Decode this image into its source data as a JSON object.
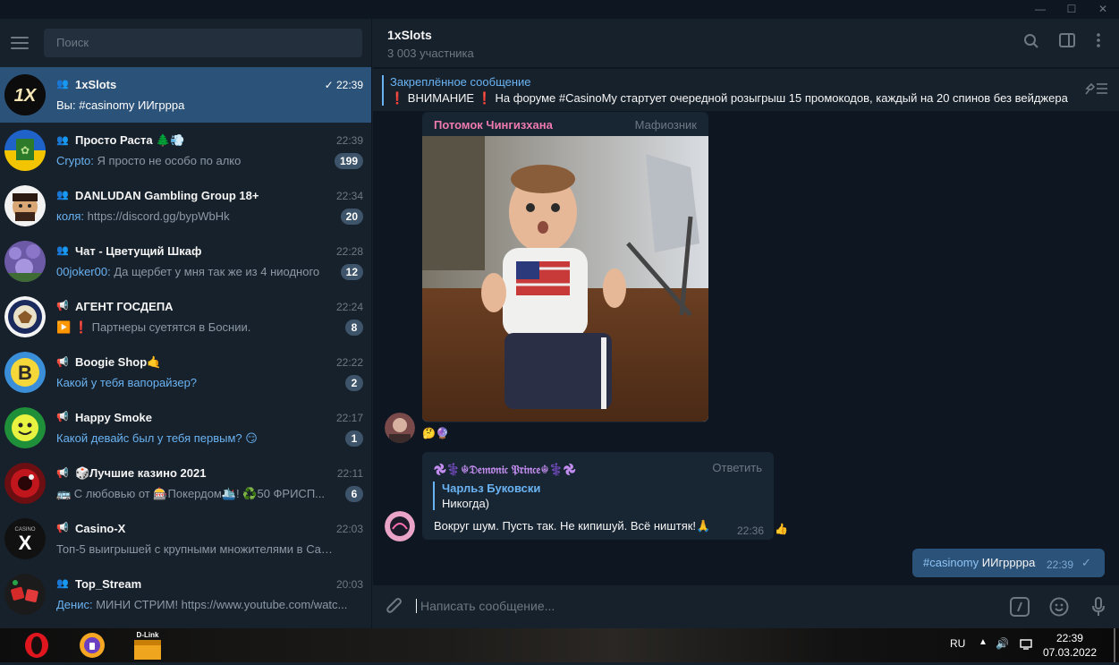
{
  "window": {
    "minimize": "—",
    "maximize": "☐",
    "close": "✕"
  },
  "sidebar": {
    "search_placeholder": "Поиск",
    "chats": [
      {
        "title": "1xSlots",
        "time": "22:39",
        "preview": "Вы: #casinomy ИИгррра",
        "from": "",
        "badge": "",
        "type": "group",
        "active": true
      },
      {
        "title": "Просто Раста 🌲💨",
        "time": "22:39",
        "from": "Crypto:",
        "preview": " Я просто не особо по алко",
        "badge": "199",
        "type": "group"
      },
      {
        "title": "DANLUDAN Gambling Group 18+",
        "time": "22:34",
        "from": "коля:",
        "preview": " https://discord.gg/bypWbHk",
        "badge": "20",
        "type": "group"
      },
      {
        "title": "Чат - Цветущий Шкаф",
        "time": "22:28",
        "from": "00joker00:",
        "preview": " Да щербет у мня так же из 4 ниодного",
        "badge": "12",
        "type": "group"
      },
      {
        "title": "АГЕНТ ГОСДЕПА",
        "time": "22:24",
        "from": "",
        "preview": "▶️ ❗ Партнеры суетятся в Боснии.",
        "badge": "8",
        "type": "channel"
      },
      {
        "title": "Boogie Shop🤙",
        "time": "22:22",
        "from": "",
        "preview": "Какой у тебя вапорайзер?",
        "badge": "2",
        "type": "channel",
        "link": true
      },
      {
        "title": "Happy Smoke",
        "time": "22:17",
        "from": "",
        "preview": "Какой девайс был у тебя первым? 😏",
        "badge": "1",
        "type": "channel",
        "link": true
      },
      {
        "title": "🎲Лучшие казино 2021",
        "time": "22:11",
        "from": "",
        "preview": "🚌 С любовью от 🎰Покердом🛳️!  ♻️50 ФРИСП...",
        "badge": "6",
        "type": "channel"
      },
      {
        "title": "Casino-X",
        "time": "22:03",
        "from": "",
        "preview": "Топ-5 выигрышей с крупными множителями в Casin...",
        "badge": "",
        "type": "channel"
      },
      {
        "title": "Top_Stream",
        "time": "20:03",
        "from": "Денис:",
        "preview": " МИНИ СТРИМ!  https://www.youtube.com/watc...",
        "badge": "",
        "type": "group"
      }
    ]
  },
  "header": {
    "title": "1xSlots",
    "subtitle": "3 003 участника"
  },
  "pinned": {
    "title": "Закреплённое сообщение",
    "text": "❗ ВНИМАНИЕ ❗ На форуме #CasinoMy стартует очередной розыгрыш 15 промокодов, каждый на 20 спинов без вейджера"
  },
  "messages": {
    "photo_msg": {
      "sender": "Потомок Чингизхана",
      "sender_title": "Мафиозник",
      "reactions": "🤔🔮"
    },
    "reply_msg": {
      "sender": "𖣘⚕️☬𝔇𝔢𝔪𝔬𝔫𝔦𝔠 𝔓𝔯𝔦𝔫𝔠𝔢☬⚕️𖣘",
      "action": "Ответить",
      "reply_name": "Чарльз Буковски",
      "reply_text": "Никогда)",
      "text": "Вокруг шум. Пусть так. Не кипишуй. Всё ништяк!🙏",
      "time": "22:36",
      "reaction": "👍"
    },
    "outgoing": {
      "hashtag": "#casinomy",
      "text": " ИИгрррра",
      "time": "22:39"
    }
  },
  "composer": {
    "placeholder": "Написать сообщение..."
  },
  "taskbar": {
    "lang": "RU",
    "time": "22:39",
    "date": "07.03.2022",
    "dlink_label": "D-Link"
  },
  "colors": {
    "accent": "#6ab3f3",
    "active": "#2b5278",
    "sender_pink": "#ee7aae",
    "bg": "#0e1621"
  }
}
